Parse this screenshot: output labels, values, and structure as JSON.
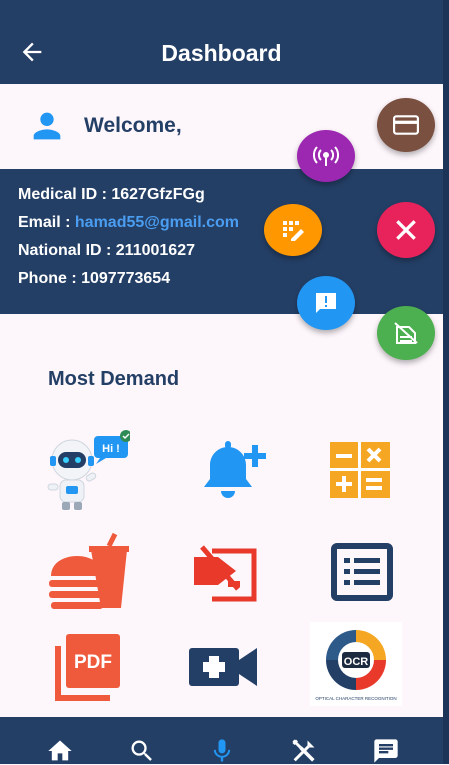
{
  "appbar": {
    "title": "Dashboard",
    "back_icon": "arrow-back-icon"
  },
  "welcome": {
    "text": "Welcome,",
    "icon": "person-icon"
  },
  "info": {
    "medical_label": "Medical ID : ",
    "medical_value": "1627GfzFGg",
    "email_label": "Email : ",
    "email_value": "hamad55@gmail.com",
    "national_label": "National ID : ",
    "national_value": "211001627",
    "phone_label": "Phone : ",
    "phone_value": "1097773654"
  },
  "section": {
    "title": "Most Demand"
  },
  "tiles": [
    {
      "name": "chatbot",
      "icon": "robot-icon"
    },
    {
      "name": "reminder",
      "icon": "bell-plus-icon"
    },
    {
      "name": "calculator",
      "icon": "calculator-icon"
    },
    {
      "name": "food",
      "icon": "burger-drink-icon"
    },
    {
      "name": "scan",
      "icon": "scan-tag-icon"
    },
    {
      "name": "list",
      "icon": "list-icon"
    },
    {
      "name": "pdf",
      "icon": "pdf-icon"
    },
    {
      "name": "video-call",
      "icon": "video-plus-icon"
    },
    {
      "name": "ocr",
      "icon": "ocr-icon"
    }
  ],
  "tile_text": {
    "robot_bubble": "Hi !",
    "pdf": "PDF",
    "ocr": "OCR",
    "ocr_caption": "OPTICAL CHARACTER RECOGNITION"
  },
  "fab": {
    "colors": {
      "card": "#7a5040",
      "broadcast": "#9c27b0",
      "dialpad": "#ff9800",
      "close": "#e8235b",
      "message": "#2196f3",
      "no-sim": "#4caf50"
    }
  },
  "colors": {
    "primary": "#243f66",
    "background": "#fdf6fb",
    "accent_blue": "#2196f3",
    "accent_orange": "#f2a020",
    "accent_red": "#f05a3c"
  },
  "bottom_nav": [
    "home-icon",
    "search-icon",
    "mic-icon",
    "tools-icon",
    "chat-icon"
  ]
}
